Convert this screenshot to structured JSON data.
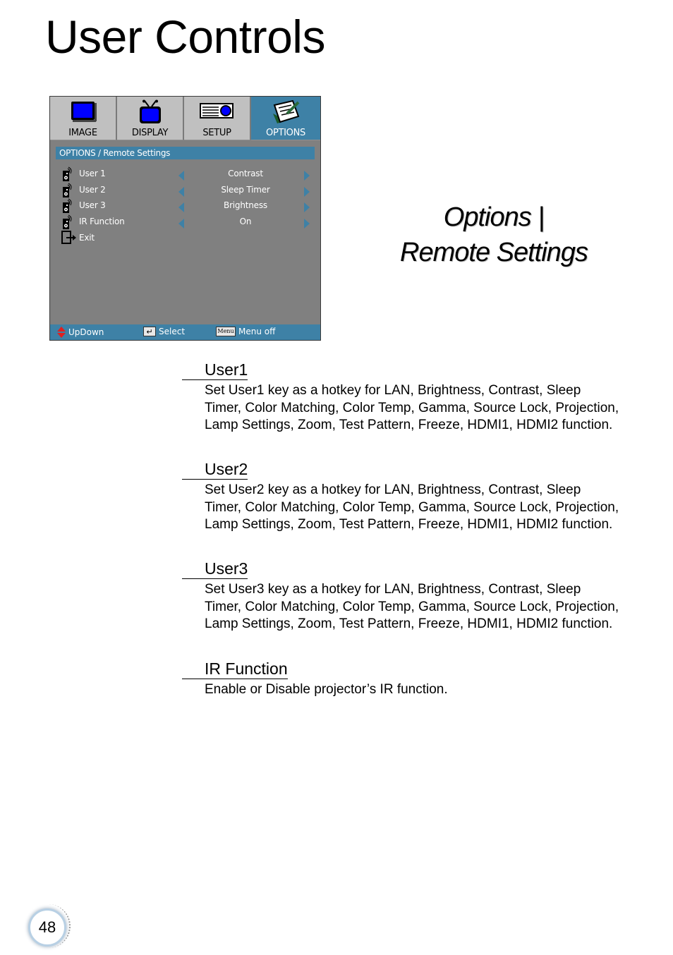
{
  "page": {
    "title": "User Controls",
    "section_heading_line1": "Options |",
    "section_heading_line2": "Remote Settings",
    "page_number": "48"
  },
  "osd": {
    "tabs": [
      {
        "label": "IMAGE",
        "icon": "monitor-icon",
        "active": false
      },
      {
        "label": "DISPLAY",
        "icon": "tv-icon",
        "active": false
      },
      {
        "label": "SETUP",
        "icon": "projector-icon",
        "active": false
      },
      {
        "label": "OPTIONS",
        "icon": "notepad-icon",
        "active": true
      }
    ],
    "breadcrumb": "OPTIONS / Remote Settings",
    "rows": [
      {
        "label": "User 1",
        "value": "Contrast",
        "icon": "remote-icon"
      },
      {
        "label": "User 2",
        "value": "Sleep Timer",
        "icon": "remote-icon"
      },
      {
        "label": "User 3",
        "value": "Brightness",
        "icon": "remote-icon"
      },
      {
        "label": "IR Function",
        "value": "On",
        "icon": "remote-icon"
      },
      {
        "label": "Exit",
        "icon": "exit-icon"
      }
    ],
    "footer": {
      "updown": "UpDown",
      "select": "Select",
      "menu_key": "Menu",
      "menu_off": "Menu off"
    },
    "colors": {
      "accent": "#3e81a6",
      "background": "#808080",
      "tab_inactive": "#c0c0c0"
    }
  },
  "items": [
    {
      "title": "User1",
      "description": "Set User1 key as a hotkey for LAN, Brightness, Contrast, Sleep Timer, Color Matching, Color Temp, Gamma, Source Lock, Projection, Lamp Settings, Zoom, Test Pattern, Freeze, HDMI1, HDMI2 function."
    },
    {
      "title": "User2",
      "description": "Set User2 key as a hotkey for LAN, Brightness, Contrast, Sleep Timer, Color Matching, Color Temp, Gamma, Source Lock, Projection, Lamp Settings, Zoom, Test Pattern, Freeze, HDMI1, HDMI2 function."
    },
    {
      "title": "User3",
      "description": "Set User3 key as a hotkey for LAN, Brightness, Contrast, Sleep Timer, Color Matching, Color Temp, Gamma, Source Lock, Projection, Lamp Settings, Zoom, Test Pattern, Freeze, HDMI1, HDMI2 function."
    },
    {
      "title": "IR Function",
      "description": "Enable or Disable projector’s IR function."
    }
  ]
}
